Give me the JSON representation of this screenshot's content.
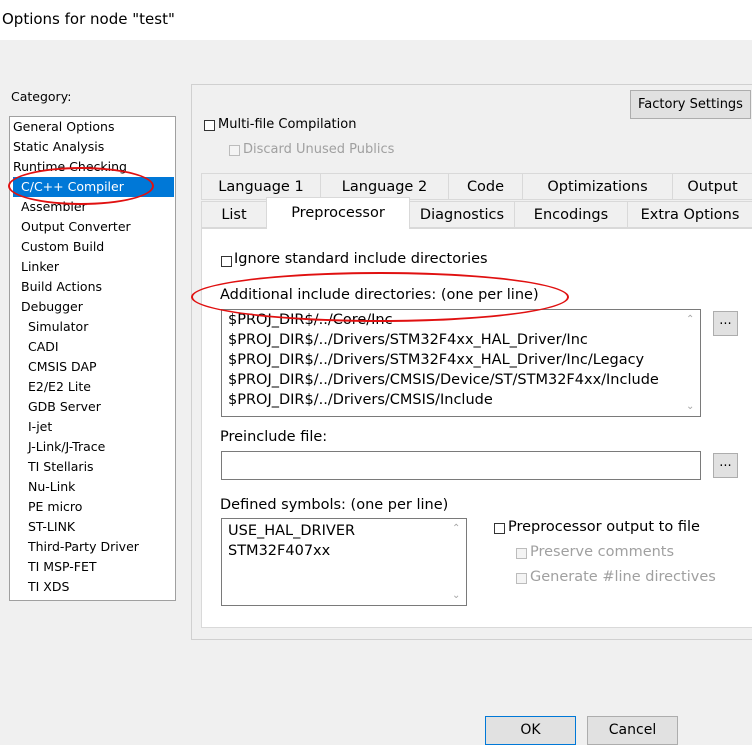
{
  "window": {
    "title": "Options for node \"test\""
  },
  "category": {
    "label": "Category:",
    "items": [
      "General Options",
      "Static Analysis",
      "Runtime Checking",
      "C/C++ Compiler",
      "Assembler",
      "Output Converter",
      "Custom Build",
      "Linker",
      "Build Actions",
      "Debugger",
      "Simulator",
      "CADI",
      "CMSIS DAP",
      "E2/E2 Lite",
      "GDB Server",
      "I-jet",
      "J-Link/J-Trace",
      "TI Stellaris",
      "Nu-Link",
      "PE micro",
      "ST-LINK",
      "Third-Party Driver",
      "TI MSP-FET",
      "TI XDS"
    ],
    "selected": "C/C++ Compiler"
  },
  "panel": {
    "factory_settings": "Factory Settings",
    "multi_file": "Multi-file Compilation",
    "discard_publics": "Discard Unused Publics",
    "tabs_row1": [
      "Language 1",
      "Language 2",
      "Code",
      "Optimizations",
      "Output"
    ],
    "tabs_row2": [
      "List",
      "Preprocessor",
      "Diagnostics",
      "Encodings",
      "Extra Options"
    ],
    "active_tab": "Preprocessor"
  },
  "preprocessor": {
    "ignore_std": "Ignore standard include directories",
    "additional_include_label": "Additional include directories: (one per line)",
    "include_dirs": [
      "$PROJ_DIR$/../Core/Inc",
      "$PROJ_DIR$/../Drivers/STM32F4xx_HAL_Driver/Inc",
      "$PROJ_DIR$/../Drivers/STM32F4xx_HAL_Driver/Inc/Legacy",
      "$PROJ_DIR$/../Drivers/CMSIS/Device/ST/STM32F4xx/Include",
      "$PROJ_DIR$/../Drivers/CMSIS/Include"
    ],
    "browse": "...",
    "preinclude_label": "Preinclude file:",
    "preinclude_value": "",
    "defined_label": "Defined symbols: (one per line)",
    "defined_symbols": [
      "USE_HAL_DRIVER",
      "STM32F407xx"
    ],
    "pp_output": "Preprocessor output to file",
    "preserve_comments": "Preserve comments",
    "gen_line": "Generate #line directives"
  },
  "buttons": {
    "ok": "OK",
    "cancel": "Cancel"
  },
  "colors": {
    "accent": "#0078d7",
    "highlight": "#e01010"
  }
}
